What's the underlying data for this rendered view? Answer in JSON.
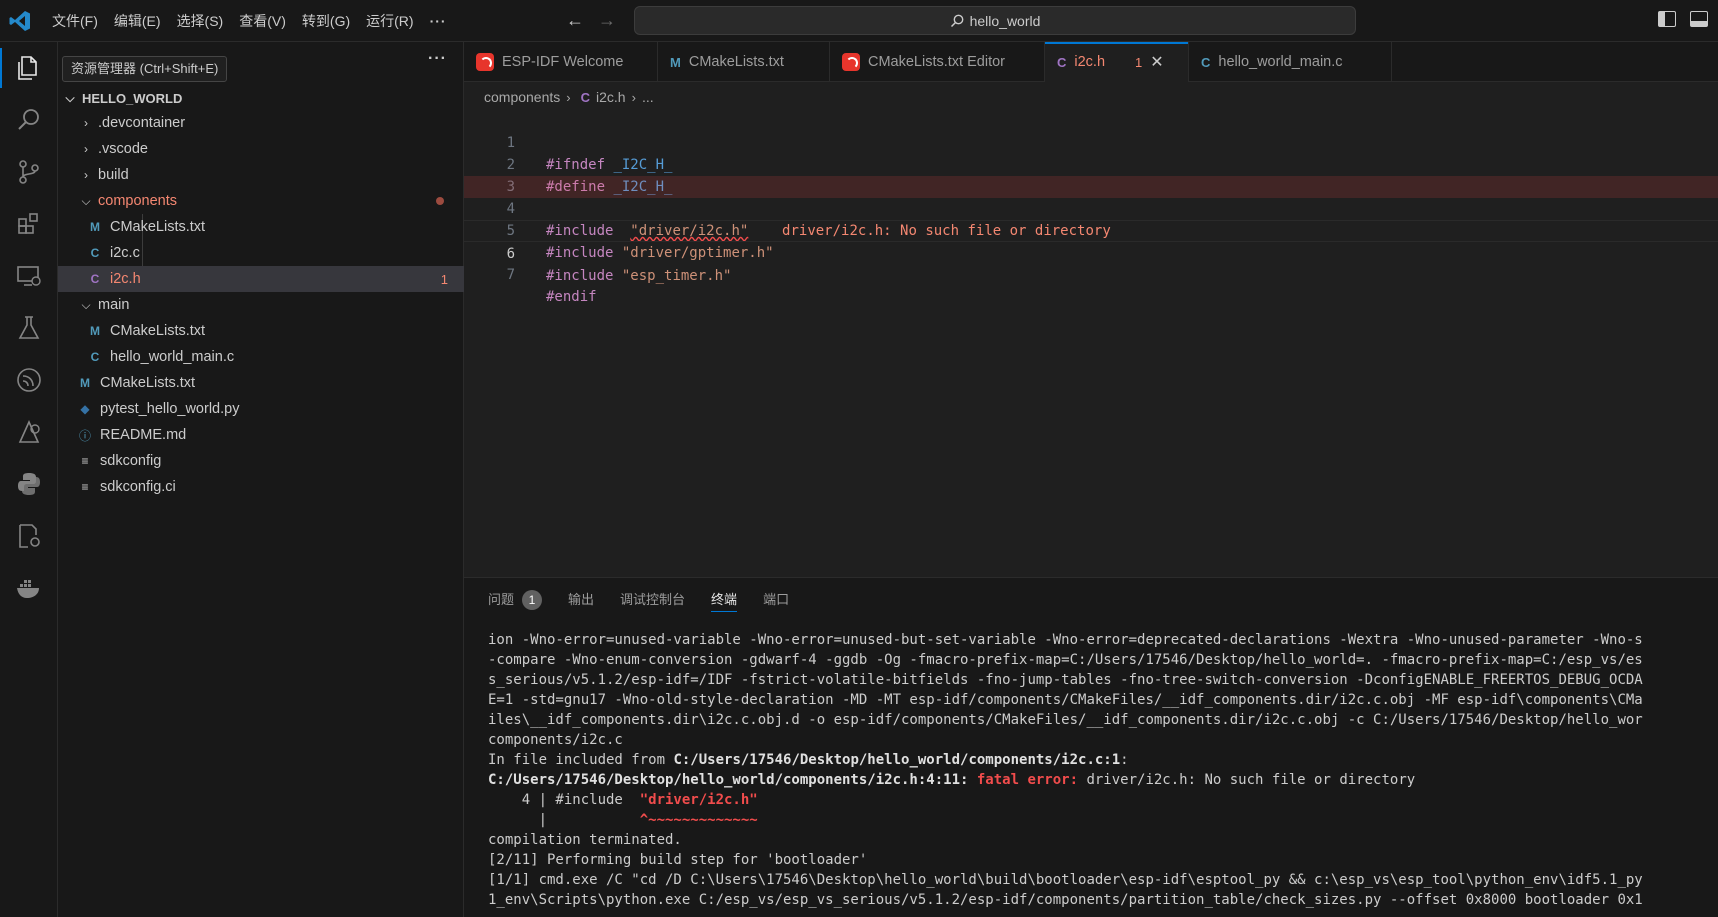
{
  "titlebar": {
    "menu": [
      "文件(F)",
      "编辑(E)",
      "选择(S)",
      "查看(V)",
      "转到(G)",
      "运行(R)",
      "···"
    ],
    "search_text": "hello_world"
  },
  "tooltip": "资源管理器 (Ctrl+Shift+E)",
  "explorer": {
    "root": "HELLO_WORLD",
    "items": [
      {
        "label": ".devcontainer",
        "type": "folder",
        "collapsed": true
      },
      {
        "label": ".vscode",
        "type": "folder",
        "collapsed": true
      },
      {
        "label": "build",
        "type": "folder",
        "collapsed": true
      },
      {
        "label": "components",
        "type": "folder",
        "collapsed": false,
        "error": true
      },
      {
        "label": "CMakeLists.txt",
        "type": "cmake"
      },
      {
        "label": "i2c.c",
        "type": "c"
      },
      {
        "label": "i2c.h",
        "type": "h",
        "error": true,
        "badge": "1",
        "selected": true
      },
      {
        "label": "main",
        "type": "folder",
        "collapsed": false
      },
      {
        "label": "CMakeLists.txt",
        "type": "cmake"
      },
      {
        "label": "hello_world_main.c",
        "type": "c"
      },
      {
        "label": "CMakeLists.txt",
        "type": "cmake"
      },
      {
        "label": "pytest_hello_world.py",
        "type": "python"
      },
      {
        "label": "README.md",
        "type": "info"
      },
      {
        "label": "sdkconfig",
        "type": "lines"
      },
      {
        "label": "sdkconfig.ci",
        "type": "lines"
      }
    ]
  },
  "tabs": [
    {
      "label": "ESP-IDF Welcome",
      "icon": "esp-icon"
    },
    {
      "label": "CMakeLists.txt",
      "icon": "M"
    },
    {
      "label": "CMakeLists.txt Editor",
      "icon": "esp-icon"
    },
    {
      "label": "i2c.h",
      "icon": "C",
      "count": "1",
      "active": true
    },
    {
      "label": "hello_world_main.c",
      "icon": "C"
    }
  ],
  "breadcrumb": {
    "folder": "components",
    "file": "i2c.h",
    "rest": "..."
  },
  "code": {
    "lines": [
      "1",
      "2",
      "3",
      "4",
      "5",
      "6",
      "7"
    ],
    "l1_kw": "#ifndef",
    "l1_mac": "_I2C_H_",
    "l2_kw": "#define",
    "l2_mac": "_I2C_H_",
    "l4_kw": "#include",
    "l4_str": "\"driver/i2c.h\"",
    "l4_err": "driver/i2c.h: No such file or directory",
    "l5_kw": "#include",
    "l5_str": "\"driver/gptimer.h\"",
    "l6_kw": "#include",
    "l6_str": "\"esp_timer.h\"",
    "l7_kw": "#endif"
  },
  "panel": {
    "tabs": [
      "问题",
      "输出",
      "调试控制台",
      "终端",
      "端口"
    ],
    "problems_count": "1",
    "terminal": {
      "line1": "ion -Wno-error=unused-variable -Wno-error=unused-but-set-variable -Wno-error=deprecated-declarations -Wextra -Wno-unused-parameter -Wno-s",
      "line2": "-compare -Wno-enum-conversion -gdwarf-4 -ggdb -Og -fmacro-prefix-map=C:/Users/17546/Desktop/hello_world=. -fmacro-prefix-map=C:/esp_vs/es",
      "line3": "s_serious/v5.1.2/esp-idf=/IDF -fstrict-volatile-bitfields -fno-jump-tables -fno-tree-switch-conversion -DconfigENABLE_FREERTOS_DEBUG_OCDA",
      "line4": "E=1 -std=gnu17 -Wno-old-style-declaration -MD -MT esp-idf/components/CMakeFiles/__idf_components.dir/i2c.c.obj -MF esp-idf\\components\\CMa",
      "line5": "iles\\__idf_components.dir\\i2c.c.obj.d -o esp-idf/components/CMakeFiles/__idf_components.dir/i2c.c.obj -c C:/Users/17546/Desktop/hello_wor",
      "line6": "components/i2c.c",
      "line7_pre": "In file included from ",
      "line7_bold": "C:/Users/17546/Desktop/hello_world/components/i2c.c:1",
      "line7_post": ":",
      "line8_bold": "C:/Users/17546/Desktop/hello_world/components/i2c.h:4:11: ",
      "line8_fatal": "fatal error: ",
      "line8_post": "driver/i2c.h: No such file or directory",
      "line9_pre": "    4 | #include  ",
      "line9_red": "\"driver/i2c.h\"",
      "line10_pre": "      |           ",
      "line10_red": "^~~~~~~~~~~~~~",
      "line11": "compilation terminated.",
      "line12": "[2/11] Performing build step for 'bootloader'",
      "line13": "[1/1] cmd.exe /C \"cd /D C:\\Users\\17546\\Desktop\\hello_world\\build\\bootloader\\esp-idf\\esptool_py && c:\\esp_vs\\esp_tool\\python_env\\idf5.1_py",
      "line14": "1_env\\Scripts\\python.exe C:/esp_vs/esp_vs_serious/v5.1.2/esp-idf/components/partition_table/check_sizes.py --offset 0x8000 bootloader 0x1"
    }
  },
  "colors": {
    "accent": "#0078d4",
    "error": "#f48771",
    "keyword": "#c586c0",
    "string": "#ce9178",
    "macro": "#569cd6"
  }
}
